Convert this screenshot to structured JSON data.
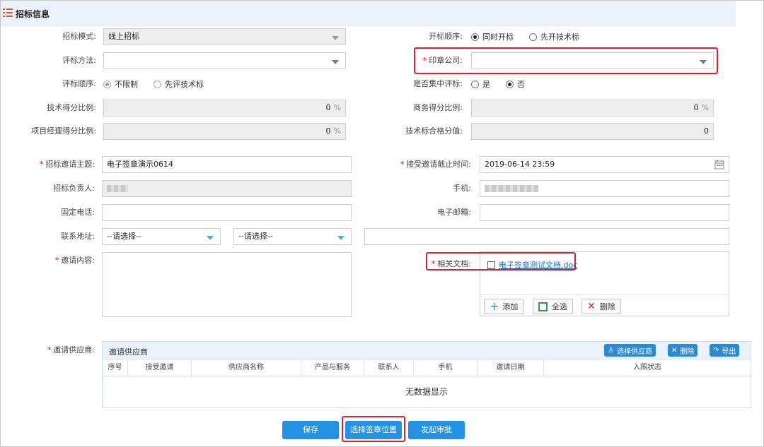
{
  "header": {
    "title": "招标信息"
  },
  "form": {
    "mode": {
      "label": "招标模式:",
      "value": "线上招标"
    },
    "open_order": {
      "label": "开标顺序:",
      "options": [
        "同时开标",
        "先开技术标"
      ],
      "selected": "同时开标"
    },
    "eval_method": {
      "label": "评标方法:",
      "value": ""
    },
    "seal_company": {
      "label": "印章公司:",
      "value": ""
    },
    "eval_order": {
      "label": "评标顺序:",
      "options": [
        "不限制",
        "先评技术标"
      ],
      "selected": "不限制"
    },
    "central_eval": {
      "label": "是否集中评标:",
      "options": [
        "是",
        "否"
      ],
      "selected": "否"
    },
    "tech_ratio": {
      "label": "技术得分比例:",
      "value": "0",
      "unit": "%"
    },
    "biz_ratio": {
      "label": "商务得分比例:",
      "value": "0",
      "unit": "%"
    },
    "pm_ratio": {
      "label": "项目经理得分比例:",
      "value": "0",
      "unit": "%"
    },
    "tech_pass": {
      "label": "技术标合格分值:",
      "value": "0"
    },
    "invite_subject": {
      "label": "招标邀请主题:",
      "value": "电子签章演示0614"
    },
    "deadline": {
      "label": "接受邀请截止时间:",
      "value": "2019-06-14 23:59"
    },
    "owner": {
      "label": "招标负责人:"
    },
    "mobile": {
      "label": "手机:"
    },
    "phone": {
      "label": "固定电话:",
      "value": ""
    },
    "email": {
      "label": "电子邮箱:",
      "value": ""
    },
    "address": {
      "label": "联系地址:",
      "select1": "--请选择--",
      "select2": "--请选择--",
      "detail": ""
    },
    "invite_content": {
      "label": "邀请内容:",
      "value": ""
    },
    "docs": {
      "label": "相关文档:",
      "files": [
        "电子签章测试文档.doc"
      ],
      "add": "添加",
      "select_all": "全选",
      "delete": "删除"
    }
  },
  "suppliers": {
    "label": "邀请供应商:",
    "panel_title": "邀请供应商",
    "btn_select": "选择供应商",
    "btn_delete": "删除",
    "btn_export": "导出",
    "columns": [
      "序号",
      "接受邀请",
      "供应商名称",
      "产品与服务",
      "联系人",
      "手机",
      "邀请日期",
      "入围状态"
    ],
    "empty": "无数据显示"
  },
  "actions": {
    "save": "保存",
    "seal_position": "选择签章位置",
    "submit": "发起审批"
  },
  "colors": {
    "required": "#d9232d",
    "accent": "#2394e3",
    "header_bg": "#eaf3fb"
  }
}
